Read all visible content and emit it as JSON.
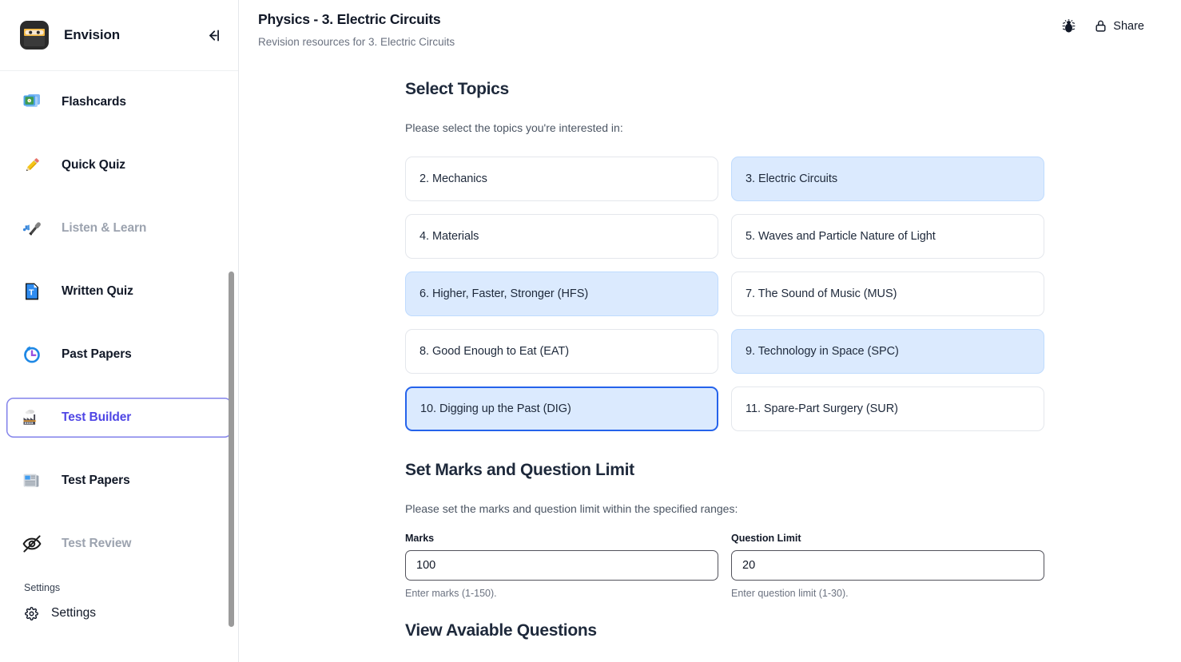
{
  "sidebar": {
    "brand": {
      "logo_icon": "ninja-emoji",
      "name": "Envision",
      "collapse_icon": "arrow-left-to-line-icon"
    },
    "items": [
      {
        "label": "Flashcards",
        "icon": "flashcards-icon",
        "glyph": "🎞️",
        "state": "default"
      },
      {
        "label": "Quick Quiz",
        "icon": "pencil-icon",
        "glyph": "✏️",
        "state": "default"
      },
      {
        "label": "Listen & Learn",
        "icon": "microphone-icon",
        "glyph": "🎤",
        "state": "disabled"
      },
      {
        "label": "Written Quiz",
        "icon": "document-t-icon",
        "glyph": "📘",
        "state": "default"
      },
      {
        "label": "Past Papers",
        "icon": "clock-rewind-icon",
        "glyph": "🕛",
        "state": "default"
      },
      {
        "label": "Test Builder",
        "icon": "factory-icon",
        "glyph": "🏭",
        "state": "active"
      },
      {
        "label": "Test Papers",
        "icon": "newspaper-icon",
        "glyph": "📰",
        "state": "default"
      },
      {
        "label": "Test Review",
        "icon": "eye-slash-icon",
        "glyph": "",
        "state": "disabled"
      }
    ],
    "settings_section_label": "Settings",
    "settings_item": {
      "label": "Settings",
      "icon": "gear-icon"
    }
  },
  "topbar": {
    "title": "Physics - 3. Electric Circuits",
    "subtitle": "Revision resources for 3. Electric Circuits",
    "bug_icon": "bug-icon",
    "share": {
      "label": "Share",
      "icon": "lock-icon"
    }
  },
  "main": {
    "select_topics": {
      "heading": "Select Topics",
      "description": "Please select the topics you're interested in:",
      "topics": [
        {
          "label": "2. Mechanics",
          "selected": false,
          "focused": false
        },
        {
          "label": "3. Electric Circuits",
          "selected": true,
          "focused": false
        },
        {
          "label": "4. Materials",
          "selected": false,
          "focused": false
        },
        {
          "label": "5. Waves and Particle Nature of Light",
          "selected": false,
          "focused": false
        },
        {
          "label": "6. Higher, Faster, Stronger (HFS)",
          "selected": true,
          "focused": false
        },
        {
          "label": "7. The Sound of Music (MUS)",
          "selected": false,
          "focused": false
        },
        {
          "label": "8. Good Enough to Eat (EAT)",
          "selected": false,
          "focused": false
        },
        {
          "label": "9. Technology in Space (SPC)",
          "selected": true,
          "focused": false
        },
        {
          "label": "10. Digging up the Past (DIG)",
          "selected": true,
          "focused": true
        },
        {
          "label": "11. Spare-Part Surgery (SUR)",
          "selected": false,
          "focused": false
        }
      ]
    },
    "marks_section": {
      "heading": "Set Marks and Question Limit",
      "description": "Please set the marks and question limit within the specified ranges:",
      "marks": {
        "label": "Marks",
        "value": "100",
        "placeholder": "100",
        "hint": "Enter marks (1-150)."
      },
      "question_limit": {
        "label": "Question Limit",
        "value": "20",
        "placeholder": "20",
        "hint": "Enter question limit (1-30)."
      }
    },
    "available_questions": {
      "heading": "View Avaiable Questions"
    }
  },
  "colors": {
    "accent_indigo": "#4f46e5",
    "selected_blue_bg": "#dbeafe",
    "focus_blue_border": "#2563eb",
    "text_dark": "#1e293b",
    "text_muted": "#6b7280"
  }
}
